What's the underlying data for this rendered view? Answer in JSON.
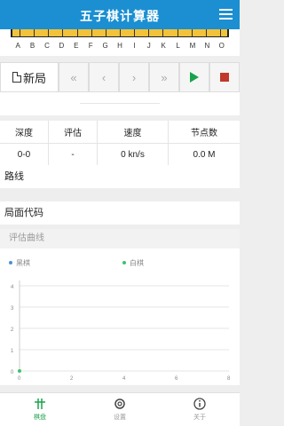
{
  "app": {
    "title": "五子棋计算器"
  },
  "board": {
    "columns": [
      "A",
      "B",
      "C",
      "D",
      "E",
      "F",
      "G",
      "H",
      "I",
      "J",
      "K",
      "L",
      "M",
      "N",
      "O"
    ]
  },
  "toolbar": {
    "new_label": "新局",
    "first_symbol": "«",
    "prev_symbol": "‹",
    "next_symbol": "›",
    "last_symbol": "»",
    "colors": {
      "play": "#1aa34a",
      "stop": "#c0392b"
    }
  },
  "stats": {
    "headers": [
      "深度",
      "评估",
      "速度",
      "节点数"
    ],
    "values": [
      "0-0",
      "-",
      "0 kn/s",
      "0.0 M"
    ]
  },
  "sections": {
    "route": "路线",
    "code": "局面代码"
  },
  "chart_data": {
    "type": "scatter",
    "title": "评估曲线",
    "series": [
      {
        "name": "黑棋",
        "color": "#4a90d9",
        "x": [],
        "y": []
      },
      {
        "name": "白棋",
        "color": "#3cc36e",
        "x": [
          0
        ],
        "y": [
          0
        ]
      }
    ],
    "xlim": [
      0,
      8
    ],
    "ylim": [
      0,
      4
    ],
    "xticks": [
      "0",
      "2",
      "4",
      "6",
      "8"
    ],
    "yticks": [
      "0",
      "1",
      "2",
      "3",
      "4"
    ],
    "legend": "top",
    "grid": true
  },
  "tabs": [
    {
      "label": "棋盘",
      "icon": "board-grid-icon",
      "active": true
    },
    {
      "label": "设置",
      "icon": "gear-icon",
      "active": false
    },
    {
      "label": "关于",
      "icon": "info-icon",
      "active": false
    }
  ],
  "colors": {
    "primary": "#1b8fd1",
    "board": "#f2c23a",
    "accent": "#1aa34a"
  }
}
